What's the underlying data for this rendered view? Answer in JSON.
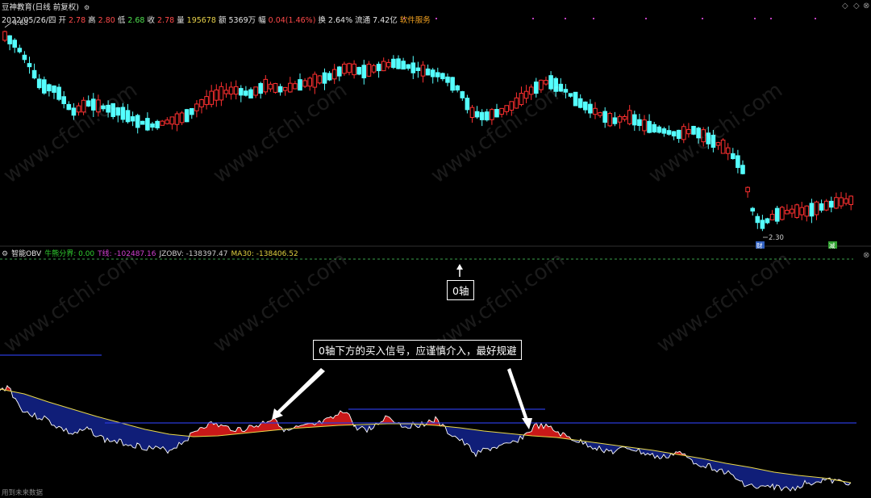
{
  "header": {
    "stock_name": "豆神教育(日线 前复权)",
    "date": "2022/05/26/四",
    "open_label": "开",
    "open_value": "2.78",
    "high_label": "高",
    "high_value": "2.80",
    "low_label": "低",
    "low_value": "2.68",
    "close_label": "收",
    "close_value": "2.78",
    "volume_label": "量",
    "volume_value": "195678",
    "amount_label": "额",
    "amount_value": "5369万",
    "change_label": "幅",
    "change_value": "0.04(1.46%)",
    "turnover_label": "换",
    "turnover_value": "2.64%",
    "float_label": "流通",
    "float_value": "7.42亿",
    "software_service": "软件服务"
  },
  "price_chart": {
    "high_label": "4.68",
    "low_label": "2.30",
    "marker_cai": "财",
    "marker_jian": "减",
    "bull_color": "#ff3030",
    "bear_color": "#54ffff"
  },
  "indicator": {
    "name": "智能OBV",
    "threshold_label": "牛熊分界: 0.00",
    "t_line_label": "T线: -102487.16",
    "jzobv_label": "JZOBV: -138397.47",
    "ma30_label": "MA30: -138406.52"
  },
  "annotations": {
    "zero_axis": "0轴",
    "buy_signal_note": "0轴下方的买入信号，应谨慎介入，最好规避"
  },
  "footer": {
    "text": "用到未来数据"
  },
  "watermark": {
    "text": "www.cfchi.com"
  },
  "chart_data": [
    {
      "type": "candlestick",
      "title": "",
      "ylim": [
        2.3,
        4.68
      ],
      "bull_color": "#ff3030",
      "bear_color": "#54ffff"
    },
    {
      "type": "area",
      "title": "",
      "series": [
        {
          "name": "JZOBV"
        },
        {
          "name": "MA30"
        }
      ],
      "threshold": 0.0
    }
  ]
}
